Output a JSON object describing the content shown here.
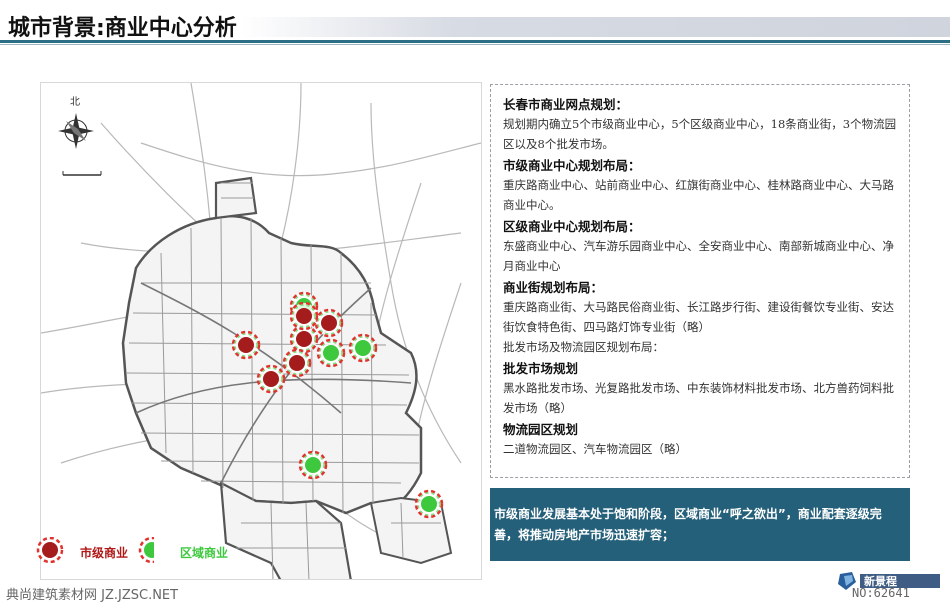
{
  "header": {
    "title": "城市背景:商业中心分析"
  },
  "map": {
    "compass_label": "北",
    "legend": [
      {
        "label": "市级商业",
        "color": "#a51c1c"
      },
      {
        "label": "区域商业",
        "color": "#3ec83e"
      }
    ],
    "colors": {
      "city_center": "#a51c1c",
      "district_center": "#3ec83e",
      "ring": "#e0332e"
    }
  },
  "panel": {
    "sections": [
      {
        "heading": "长春市商业网点规划：",
        "text": "规划期内确立5个市级商业中心，5个区级商业中心，18条商业街，3个物流园区以及8个批发市场。"
      },
      {
        "heading": "市级商业中心规划布局：",
        "text": "重庆路商业中心、站前商业中心、红旗街商业中心、桂林路商业中心、大马路商业中心。"
      },
      {
        "heading": "区级商业中心规划布局：",
        "text": "东盛商业中心、汽车游乐园商业中心、全安商业中心、南部新城商业中心、净月商业中心"
      },
      {
        "heading": "商业街规划布局：",
        "text": "重庆路商业街、大马路民俗商业街、长江路步行街、建设街餐饮专业街、安达街饮食特色街、四马路灯饰专业街（略）"
      },
      {
        "heading": "",
        "text": "批发市场及物流园区规划布局："
      },
      {
        "heading": "批发市场规划",
        "text": "黑水路批发市场、光复路批发市场、中东装饰材料批发市场、北方兽药饲料批发市场（略）"
      },
      {
        "heading": "物流园区规划",
        "text": "二道物流园区、汽车物流园区（略）"
      }
    ]
  },
  "summary": {
    "text": "市级商业发展基本处于饱和阶段，区域商业“呼之欲出”，商业配套逐级完善，将推动房地产市场迅速扩容；"
  },
  "footer": {
    "watermark": "典尚建筑素材网 JZ.JZSC.NET",
    "logo_text": "新景程",
    "number": "NO:62641"
  }
}
